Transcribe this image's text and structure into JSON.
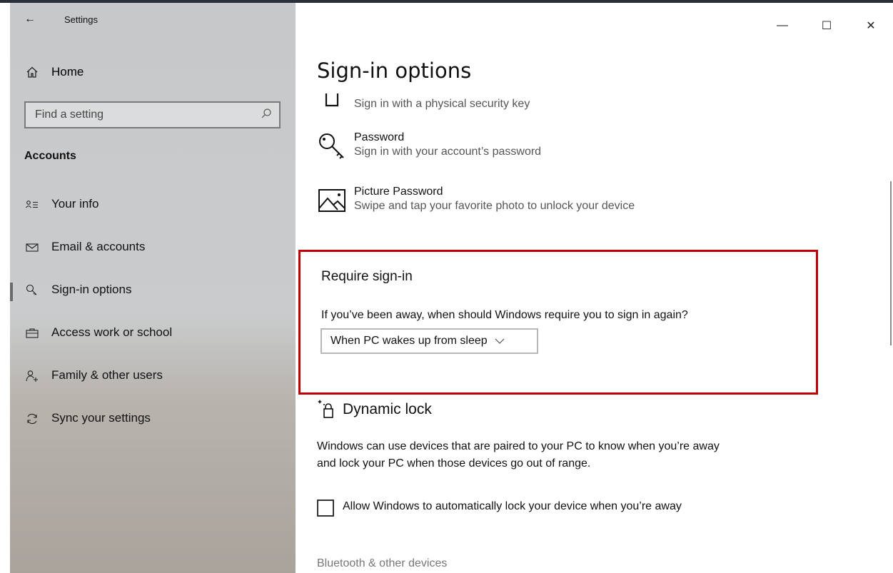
{
  "window": {
    "title": "Settings",
    "controls": {
      "minimize": "—",
      "maximize": "☐",
      "close": "✕"
    }
  },
  "sidebar": {
    "back_icon": "back-arrow-icon",
    "home_label": "Home",
    "search_placeholder": "Find a setting",
    "section_title": "Accounts",
    "items": [
      {
        "label": "Your info",
        "icon": "person-list-icon",
        "selected": false
      },
      {
        "label": "Email & accounts",
        "icon": "mail-icon",
        "selected": false
      },
      {
        "label": "Sign-in options",
        "icon": "key-icon",
        "selected": true
      },
      {
        "label": "Access work or school",
        "icon": "briefcase-icon",
        "selected": false
      },
      {
        "label": "Family & other users",
        "icon": "add-person-icon",
        "selected": false
      },
      {
        "label": "Sync your settings",
        "icon": "sync-icon",
        "selected": false
      }
    ]
  },
  "main": {
    "page_title": "Sign-in options",
    "options": [
      {
        "name": "",
        "desc": "Sign in with a physical security key",
        "icon": "security-key-icon"
      },
      {
        "name": "Password",
        "desc": "Sign in with your account’s password",
        "icon": "key-icon"
      },
      {
        "name": "Picture Password",
        "desc": "Swipe and tap your favorite photo to unlock your device",
        "icon": "picture-icon"
      }
    ],
    "require_signin": {
      "title": "Require sign-in",
      "question": "If you’ve been away, when should Windows require you to sign in again?",
      "selected_value": "When PC wakes up from sleep"
    },
    "dynamic_lock": {
      "title": "Dynamic lock",
      "description": "Windows can use devices that are paired to your PC to know when you’re away and lock your PC when those devices go out of range.",
      "checkbox_label": "Allow Windows to automatically lock your device when you’re away",
      "checked": false
    },
    "link": "Bluetooth & other devices"
  },
  "colors": {
    "highlight_border": "#c00000",
    "sidebar_bg": "#c6c8ca"
  }
}
